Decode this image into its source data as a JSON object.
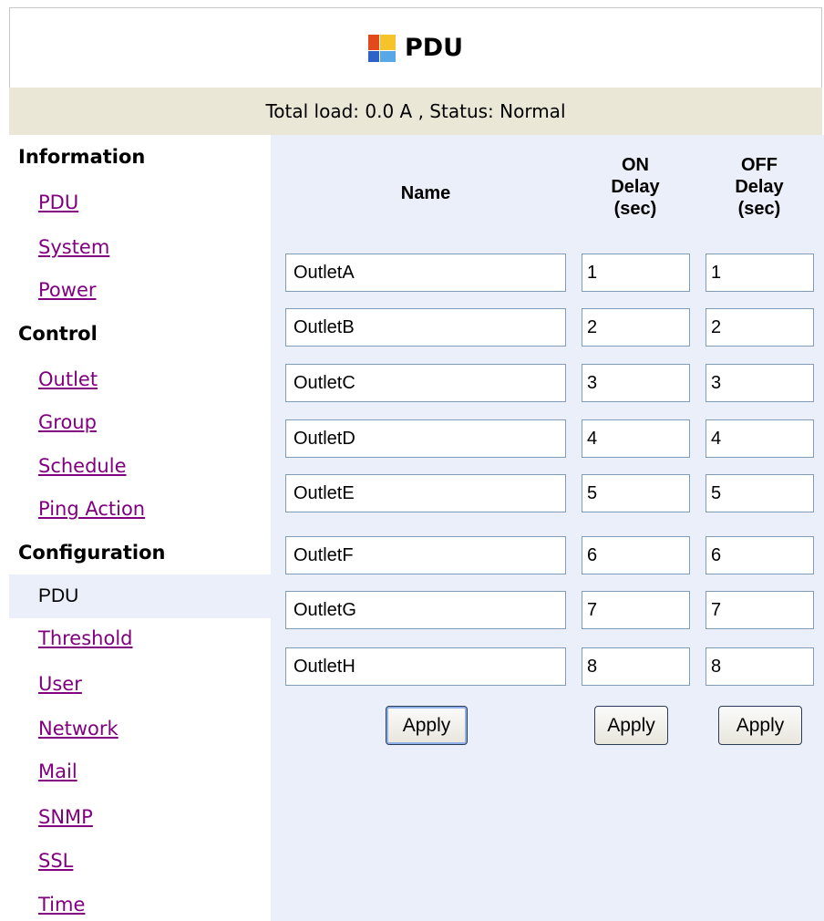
{
  "header": {
    "title": "PDU",
    "logo_icon": "pdu-logo-icon"
  },
  "status": {
    "text": "Total load: 0.0 A , Status: Normal"
  },
  "sidebar": {
    "sections": [
      {
        "heading": "Information",
        "items": [
          "PDU",
          "System",
          "Power"
        ]
      },
      {
        "heading": "Control",
        "items": [
          "Outlet",
          "Group",
          "Schedule",
          "Ping Action"
        ]
      },
      {
        "heading": "Configuration",
        "items": [
          "PDU",
          "Threshold",
          "User",
          "Network",
          "Mail",
          "SNMP",
          "SSL",
          "Time"
        ]
      }
    ],
    "active_item": "PDU",
    "link_color": "#800080",
    "active_bg": "#eaeff9"
  },
  "table": {
    "headers": {
      "name": "Name",
      "on_delay": [
        "ON",
        "Delay",
        "(sec)"
      ],
      "off_delay": [
        "OFF",
        "Delay",
        "(sec)"
      ]
    },
    "rows": [
      {
        "name": "OutletA",
        "on": "1",
        "off": "1"
      },
      {
        "name": "OutletB",
        "on": "2",
        "off": "2"
      },
      {
        "name": "OutletC",
        "on": "3",
        "off": "3"
      },
      {
        "name": "OutletD",
        "on": "4",
        "off": "4"
      },
      {
        "name": "OutletE",
        "on": "5",
        "off": "5"
      },
      {
        "name": "OutletF",
        "on": "6",
        "off": "6"
      },
      {
        "name": "OutletG",
        "on": "7",
        "off": "7"
      },
      {
        "name": "OutletH",
        "on": "8",
        "off": "8"
      }
    ],
    "buttons": {
      "apply_name": "Apply",
      "apply_on": "Apply",
      "apply_off": "Apply"
    }
  },
  "colors": {
    "status_bg": "#ebe7d6",
    "content_bg": "#eaeff9",
    "input_border": "#7f9db9"
  }
}
